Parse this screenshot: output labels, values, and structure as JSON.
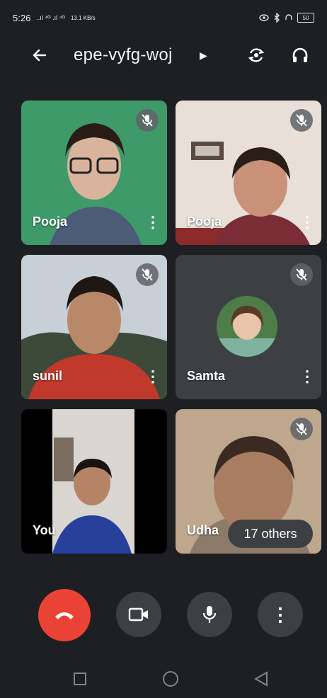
{
  "status": {
    "time": "5:26",
    "signal": "..ıl ⁴ᴳ .ıl ⁴ᴳ",
    "network_speed": "13.1 KB/s",
    "battery": "50"
  },
  "header": {
    "meeting_code": "epe-vyfg-woj"
  },
  "tiles": [
    {
      "name": "Pooja",
      "muted": true
    },
    {
      "name": "Pooja",
      "muted": true
    },
    {
      "name": "sunil",
      "muted": true
    },
    {
      "name": "Samta",
      "muted": true
    },
    {
      "name": "You",
      "muted": false
    },
    {
      "name": "Udha",
      "muted": true
    }
  ],
  "others_badge": "17 others",
  "colors": {
    "background": "#1e1f22",
    "tile": "#3c4043",
    "end_call": "#ea4335"
  },
  "icons": [
    "back-arrow-icon",
    "switch-camera-icon",
    "headphones-icon",
    "mic-off-icon",
    "more-vert-icon",
    "end-call-icon",
    "camera-icon",
    "mic-icon",
    "nav-recent-icon",
    "nav-home-icon",
    "nav-back-icon"
  ]
}
